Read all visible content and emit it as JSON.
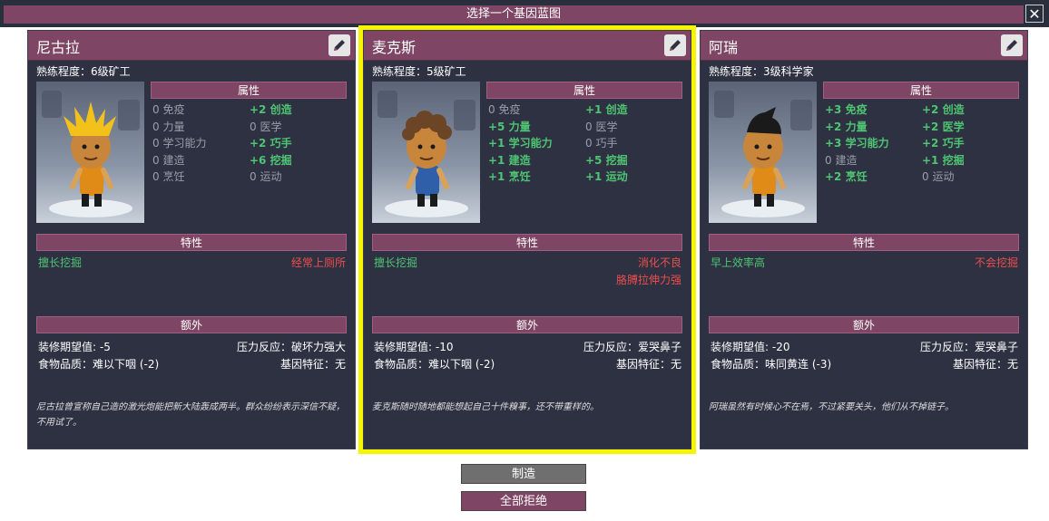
{
  "window": {
    "title": "选择一个基因蓝图",
    "close_label": "✕"
  },
  "cards": [
    {
      "name": "尼古拉",
      "proficiency": "熟练程度：6级矿工",
      "attributes_header": "属性",
      "attrs_left": [
        {
          "text": "0 免疫",
          "positive": false
        },
        {
          "text": "0 力量",
          "positive": false
        },
        {
          "text": "0 学习能力",
          "positive": false
        },
        {
          "text": "0 建造",
          "positive": false
        },
        {
          "text": "0 烹饪",
          "positive": false
        }
      ],
      "attrs_right": [
        {
          "text": "+2 创造",
          "positive": true
        },
        {
          "text": "0 医学",
          "positive": false
        },
        {
          "text": "+2 巧手",
          "positive": true
        },
        {
          "text": "+6 挖掘",
          "positive": true
        },
        {
          "text": "0 运动",
          "positive": false
        }
      ],
      "traits_header": "特性",
      "good_traits": [
        "擅长挖掘"
      ],
      "bad_traits": [
        "经常上厕所"
      ],
      "extra_header": "额外",
      "decor_expectation": "装修期望值: -5",
      "stress_reaction": "压力反应：破坏力强大",
      "food_quality": "食物品质：难以下咽 (-2)",
      "gene_trait": "基因特征：无",
      "description": "尼古拉曾宣称自己造的激光炮能把新大陆轰成两半。群众纷纷表示深信不疑，不用试了。",
      "hair_color": "#f2c21a"
    },
    {
      "name": "麦克斯",
      "proficiency": "熟练程度：5级矿工",
      "attributes_header": "属性",
      "attrs_left": [
        {
          "text": "0 免疫",
          "positive": false
        },
        {
          "text": "+5 力量",
          "positive": true
        },
        {
          "text": "+1 学习能力",
          "positive": true
        },
        {
          "text": "+1 建造",
          "positive": true
        },
        {
          "text": "+1 烹饪",
          "positive": true
        }
      ],
      "attrs_right": [
        {
          "text": "+1 创造",
          "positive": true
        },
        {
          "text": "0 医学",
          "positive": false
        },
        {
          "text": "0 巧手",
          "positive": false
        },
        {
          "text": "+5 挖掘",
          "positive": true
        },
        {
          "text": "+1 运动",
          "positive": true
        }
      ],
      "traits_header": "特性",
      "good_traits": [
        "擅长挖掘"
      ],
      "bad_traits": [
        "消化不良",
        "胳膊拉伸力强"
      ],
      "extra_header": "额外",
      "decor_expectation": "装修期望值: -10",
      "stress_reaction": "压力反应：爱哭鼻子",
      "food_quality": "食物品质：难以下咽 (-2)",
      "gene_trait": "基因特征：无",
      "description": "麦克斯随时随地都能想起自己十件糗事，还不带重样的。",
      "hair_color": "#6b4525"
    },
    {
      "name": "阿瑞",
      "proficiency": "熟练程度：3级科学家",
      "attributes_header": "属性",
      "attrs_left": [
        {
          "text": "+3 免疫",
          "positive": true
        },
        {
          "text": "+2 力量",
          "positive": true
        },
        {
          "text": "+3 学习能力",
          "positive": true
        },
        {
          "text": "0 建造",
          "positive": false
        },
        {
          "text": "+2 烹饪",
          "positive": true
        }
      ],
      "attrs_right": [
        {
          "text": "+2 创造",
          "positive": true
        },
        {
          "text": "+2 医学",
          "positive": true
        },
        {
          "text": "+2 巧手",
          "positive": true
        },
        {
          "text": "+1 挖掘",
          "positive": true
        },
        {
          "text": "0 运动",
          "positive": false
        }
      ],
      "traits_header": "特性",
      "good_traits": [
        "早上效率高"
      ],
      "bad_traits": [
        "不会挖掘"
      ],
      "extra_header": "额外",
      "decor_expectation": "装修期望值: -20",
      "stress_reaction": "压力反应：爱哭鼻子",
      "food_quality": "食物品质：味同黄连 (-3)",
      "gene_trait": "基因特征：无",
      "description": "阿瑞虽然有时候心不在焉，不过紧要关头，他们从不掉链子。",
      "hair_color": "#1a1a1a"
    }
  ],
  "buttons": {
    "print": "制造",
    "reject_all": "全部拒绝"
  }
}
